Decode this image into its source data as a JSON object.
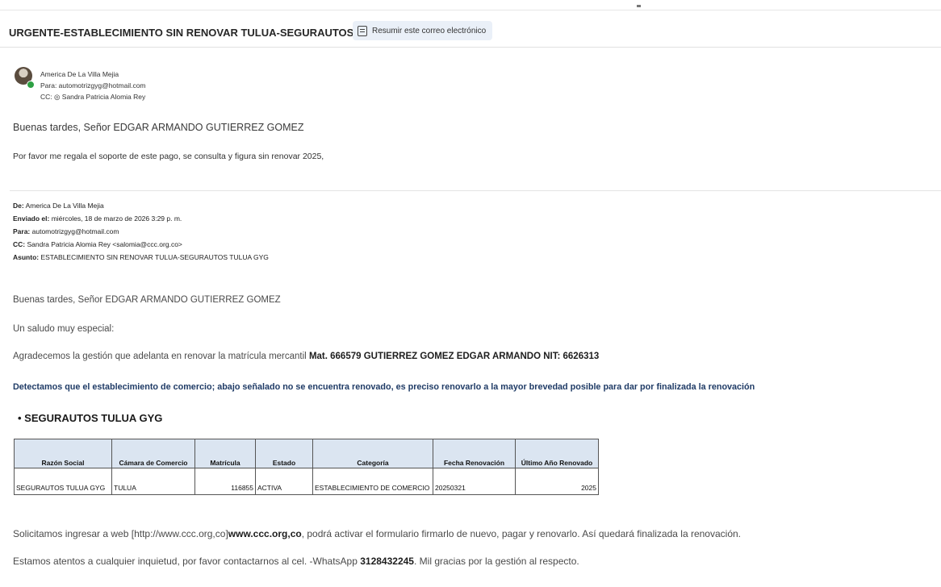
{
  "email": {
    "subject": "URGENTE-ESTABLECIMIENTO SIN RENOVAR TULUA-SEGURAUTOS TULUA GYG",
    "summarize_button": "Resumir este correo electrónico",
    "sender": "America De La Villa Mejia",
    "to": "Para: automotrizgyg@hotmail.com",
    "cc": "CC: ◎ Sandra Patricia Alomia Rey",
    "greeting": "Buenas tardes, Señor EDGAR ARMANDO GUTIERREZ GOMEZ",
    "request": "Por favor me regala el soporte de este pago, se consulta y figura sin renovar 2025,"
  },
  "forwarded": {
    "de_label": "De:",
    "de_value": " America De La Villa Mejia",
    "enviado_label": "Enviado el:",
    "enviado_value": " miércoles, 18 de marzo de 2026 3:29 p. m.",
    "para_label": "Para:",
    "para_value": " automotrizgyg@hotmail.com",
    "cc_label": "CC:",
    "cc_value": " Sandra Patricia Alomia Rey <salomia@ccc.org.co>",
    "asunto_label": "Asunto:",
    "asunto_value": " ESTABLECIMIENTO SIN RENOVAR TULUA-SEGURAUTOS TULUA GYG",
    "greeting": "Buenas tardes, Señor EDGAR ARMANDO GUTIERREZ GOMEZ",
    "salute": "Un saludo muy especial:",
    "thanks_text": "Agradecemos la gestión que adelanta en renovar la matrícula mercantil ",
    "thanks_bold": "Mat. 666579 GUTIERREZ GOMEZ EDGAR ARMANDO NIT: 6626313",
    "detect": "Detectamos que el establecimiento de comercio; abajo señalado no se encuentra renovado, es preciso renovarlo a la mayor brevedad posible para dar por finalizada la renovación",
    "bullet": "SEGURAUTOS TULUA GYG",
    "table": {
      "headers": [
        "Razón Social",
        "Cámara de Comercio",
        "Matrícula",
        "Estado",
        "Categoría",
        "Fecha Renovación",
        "Último Año Renovado"
      ],
      "row": [
        "SEGURAUTOS TULUA GYG",
        "TULUA",
        "116855",
        "ACTIVA",
        "ESTABLECIMIENTO DE COMERCIO",
        "20250321",
        "2025"
      ]
    },
    "solicit_a": "Solicitamos ingresar a web [http://www.ccc.org,co]",
    "solicit_link": "www.ccc.org,co",
    "solicit_b": ", podrá activar el formulario firmarlo de nuevo, pagar y renovarlo. Así quedará finalizada la renovación.",
    "contact_a": "Estamos atentos a cualquier inquietud, por favor contactarnos al cel. -WhatsApp ",
    "contact_phone": "3128432245",
    "contact_b": ". Mil gracias por la gestión al respecto."
  }
}
